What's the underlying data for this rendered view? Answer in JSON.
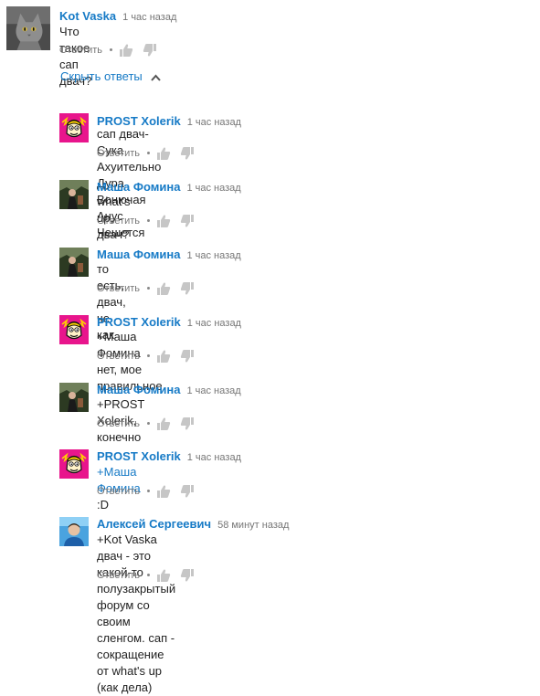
{
  "top_comment": {
    "author": "Kot Vaska",
    "time": "1 час назад",
    "text": "Что такое сап двач?",
    "reply_label": "Ответить"
  },
  "hide_replies_label": "Скрыть ответы",
  "replies": [
    {
      "author": "PROST Xolerik",
      "time": "1 час назад",
      "text": "сап двач- Сука Ахуительно Дура Вонючая Анус Чешется",
      "reply_label": "Ответить"
    },
    {
      "author": "Маша Фомина",
      "time": "1 час назад",
      "text": "what's up, двач?",
      "reply_label": "Ответить"
    },
    {
      "author": "Маша Фомина",
      "time": "1 час назад",
      "text": "то есть, двач, че как",
      "reply_label": "Ответить"
    },
    {
      "author": "PROST Xolerik",
      "time": "1 час назад",
      "text": "+Маша Фомина нет, мое правильное",
      "reply_label": "Ответить"
    },
    {
      "author": "Маша Фомина",
      "time": "1 час назад",
      "text": "+PROST Xolerik, конечно",
      "reply_label": "Ответить"
    },
    {
      "author": "PROST Xolerik",
      "time": "1 час назад",
      "mention": "+Маша Фомина",
      "text": " :D",
      "reply_label": "Ответить"
    },
    {
      "author": "Алексей Сергеевич",
      "time": "58 минут назад",
      "text_line1": "+Kot Vaska двач - это какой-то полузакрытый форум со своим сленгом. сап -",
      "text_line2": "сокращение от what's up (как дела)",
      "reply_label": "Ответить"
    }
  ],
  "icons": {
    "like": "thumbs-up-icon",
    "dislike": "thumbs-down-icon",
    "collapse": "chevron-up-icon"
  },
  "colors": {
    "link": "#167ac6",
    "meta": "#767676",
    "text": "#222222",
    "prost_avatar_bg": "#e8158c"
  }
}
